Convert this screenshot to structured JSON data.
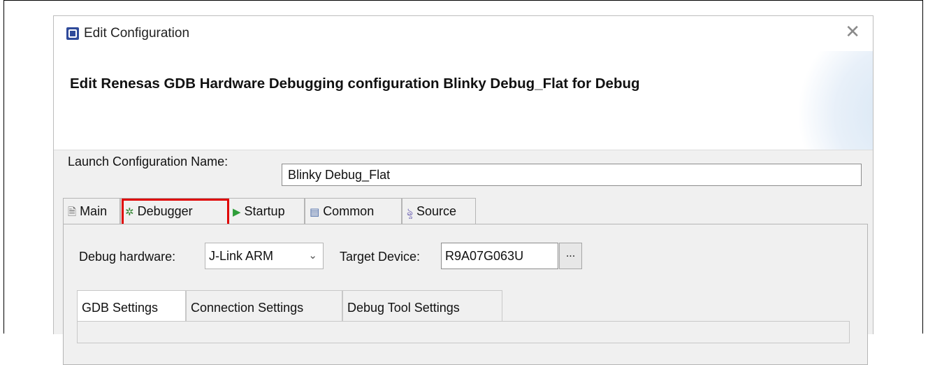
{
  "window": {
    "title": "Edit Configuration",
    "close_icon": "close-icon"
  },
  "banner": {
    "heading": "Edit Renesas GDB Hardware Debugging configuration Blinky Debug_Flat for Debug"
  },
  "launch": {
    "label": "Launch Configuration Name:",
    "value": "Blinky Debug_Flat"
  },
  "tabs": [
    {
      "label": "Main",
      "icon": "document-icon"
    },
    {
      "label": "Debugger",
      "icon": "bug-icon",
      "highlighted": true
    },
    {
      "label": "Startup",
      "icon": "play-icon"
    },
    {
      "label": "Common",
      "icon": "window-icon"
    },
    {
      "label": "Source",
      "icon": "source-icon"
    }
  ],
  "debugger": {
    "hardware_label": "Debug hardware:",
    "hardware_value": "J-Link ARM",
    "target_label": "Target Device:",
    "target_value": "R9A07G063U",
    "browse_label": "..."
  },
  "subtabs": [
    {
      "label": "GDB Settings",
      "active": true
    },
    {
      "label": "Connection Settings"
    },
    {
      "label": "Debug Tool Settings"
    }
  ],
  "colors": {
    "highlight": "#e00000",
    "startup_icon": "#2e9e3a"
  }
}
